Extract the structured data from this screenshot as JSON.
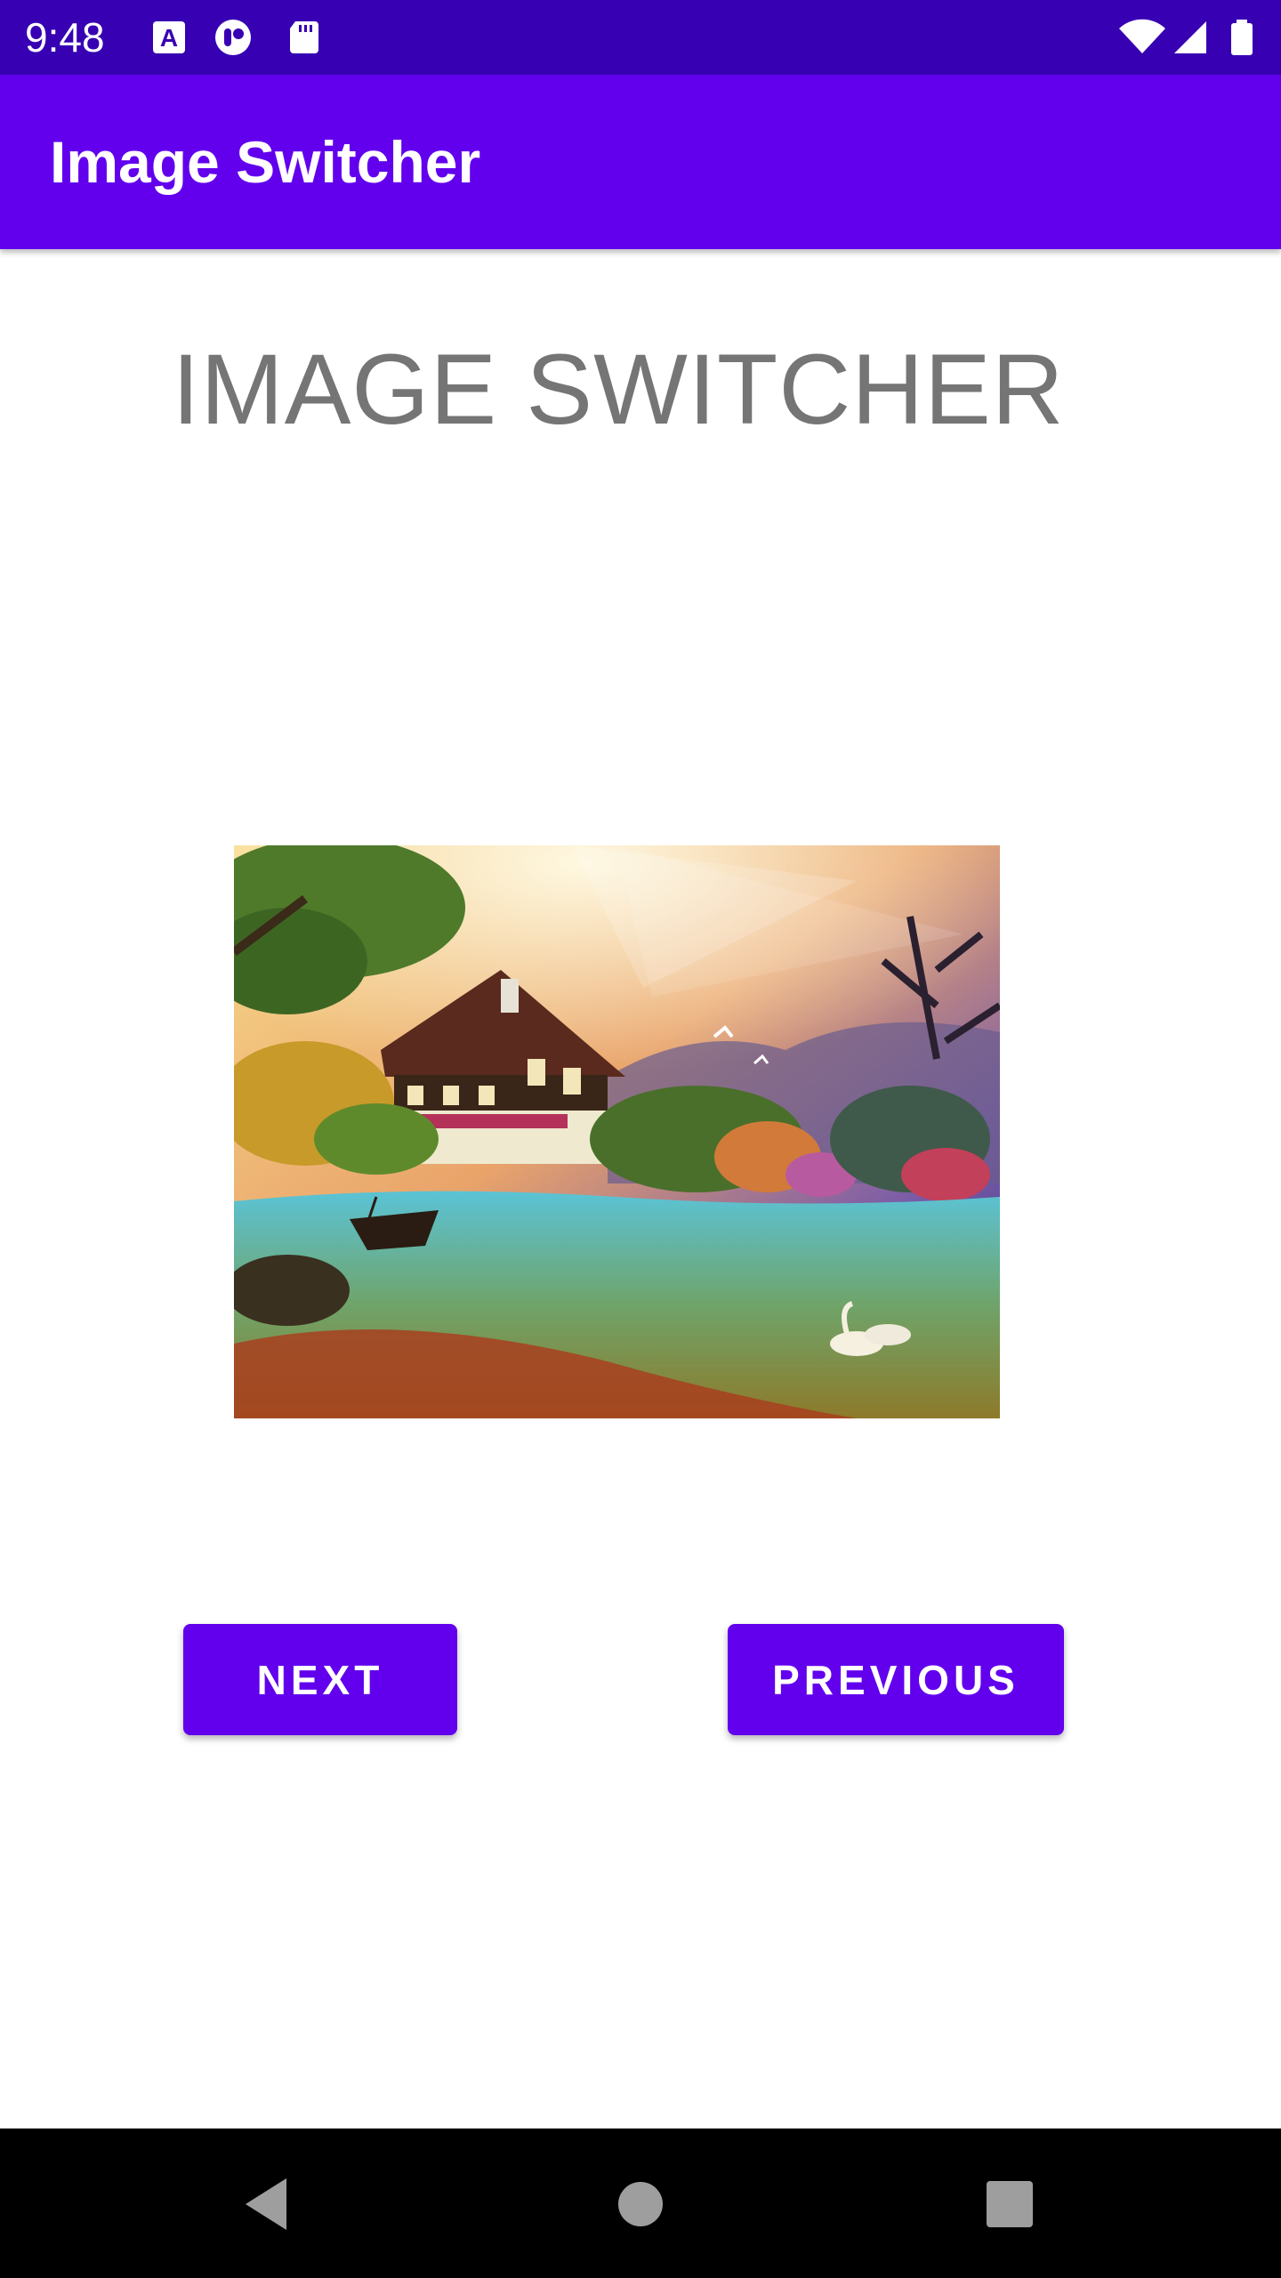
{
  "status_bar": {
    "time": "9:48",
    "background": "#3700b3",
    "left_icons": [
      "autofill-a-icon",
      "app-notification-icon",
      "sd-card-icon"
    ],
    "right_icons": [
      "wifi-icon",
      "cell-signal-icon",
      "battery-icon"
    ]
  },
  "app_bar": {
    "title": "Image Switcher",
    "background": "#6200ee"
  },
  "main": {
    "heading": "IMAGE SWITCHER",
    "heading_color": "#757575",
    "image": {
      "subject": "landscape-painting"
    },
    "buttons": {
      "next_label": "NEXT",
      "previous_label": "PREVIOUS",
      "color": "#6200ee"
    }
  },
  "nav_bar": {
    "buttons": [
      "back-icon",
      "home-icon",
      "recents-icon"
    ]
  }
}
